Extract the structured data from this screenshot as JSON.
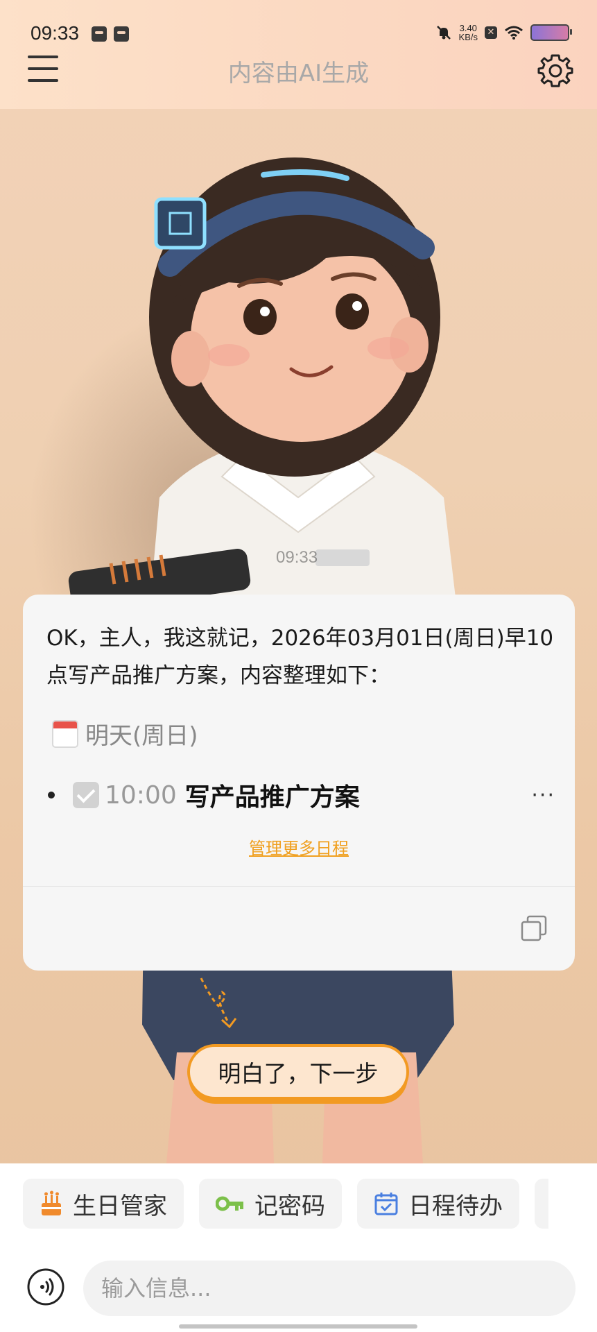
{
  "status_bar": {
    "time": "09:33",
    "net_speed_value": "3.40",
    "net_speed_unit": "KB/s",
    "icons": [
      "mail-icon",
      "message-icon",
      "mute-bell-icon",
      "close-box-icon",
      "wifi-icon",
      "battery-icon"
    ]
  },
  "header": {
    "title": "内容由AI生成",
    "menu_icon": "hamburger-menu-icon",
    "settings_icon": "gear-icon"
  },
  "scene": {
    "badge_time": "09:33"
  },
  "message_card": {
    "text": "OK，主人，我这就记，2026年03月01日(周日)早10点写产品推广方案，内容整理如下：",
    "date_label": "明天(周日)",
    "task": {
      "time": "10:00",
      "title": "写产品推广方案",
      "more": "···"
    },
    "manage_link": "管理更多日程"
  },
  "guide": {
    "next_label": "明白了，下一步"
  },
  "quick_actions": [
    {
      "label": "生日管家",
      "icon": "birthday-cake-icon",
      "color": "#f08a2c"
    },
    {
      "label": "记密码",
      "icon": "key-icon",
      "color": "#7cc04a"
    },
    {
      "label": "日程待办",
      "icon": "calendar-check-icon",
      "color": "#4a7fe0"
    }
  ],
  "input": {
    "placeholder": "输入信息..."
  },
  "colors": {
    "accent": "#f29a22",
    "link": "#f0a020",
    "header_bg": "#fbd9c2"
  }
}
